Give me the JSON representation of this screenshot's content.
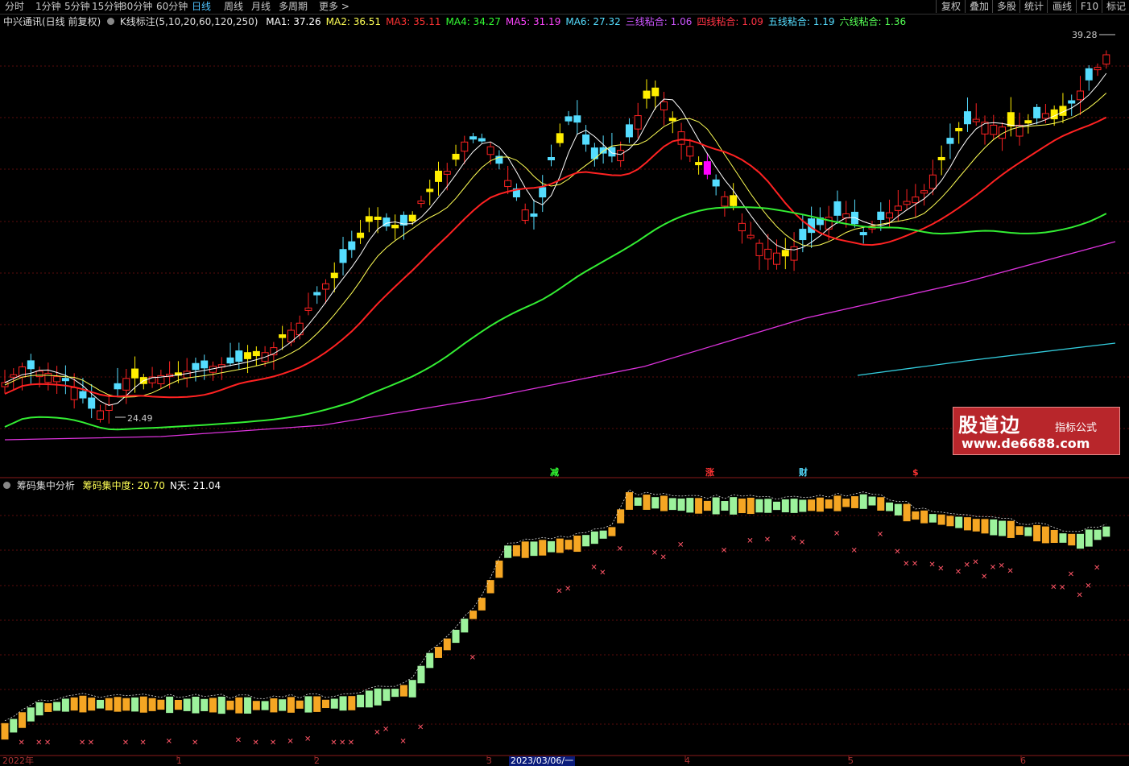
{
  "toolbar": {
    "left": [
      "分时",
      "1分钟",
      "5分钟",
      "15分钟",
      "30分钟",
      "60分钟",
      "日线",
      "周线",
      "月线",
      "多周期",
      "更多 >"
    ],
    "active_index": 6,
    "right": [
      "复权",
      "叠加",
      "多股",
      "统计",
      "画线",
      "F10",
      "标记"
    ]
  },
  "main_legend": {
    "stock": "中兴通讯(日线 前复权)",
    "indicator": "K线标注(5,10,20,60,120,250)",
    "items": [
      {
        "label": "MA1: 37.26",
        "color": "#ffffff"
      },
      {
        "label": "MA2: 36.51",
        "color": "#ffff55"
      },
      {
        "label": "MA3: 35.11",
        "color": "#ff3333"
      },
      {
        "label": "MA4: 34.27",
        "color": "#33ff33"
      },
      {
        "label": "MA5: 31.19",
        "color": "#ff44ff"
      },
      {
        "label": "MA6: 27.32",
        "color": "#55ddff"
      },
      {
        "label": "三线粘合: 1.06",
        "color": "#cc55ff"
      },
      {
        "label": "四线粘合: 1.09",
        "color": "#ff3344"
      },
      {
        "label": "五线粘合: 1.19",
        "color": "#55ddff"
      },
      {
        "label": "六线粘合: 1.36",
        "color": "#55ff55"
      }
    ]
  },
  "price_labels": {
    "high": "39.28",
    "low": "24.49"
  },
  "markers": [
    {
      "text": "减",
      "color": "#33ff33"
    },
    {
      "text": "涨",
      "color": "#ff3333"
    },
    {
      "text": "财",
      "color": "#55ddff"
    },
    {
      "text": "$",
      "color": "#ff3333"
    }
  ],
  "sub_legend": {
    "name": "筹码集中分析",
    "items": [
      {
        "label": "筹码集中度: 20.70",
        "color": "#ffff55"
      },
      {
        "label": "N天: 21.04",
        "color": "#ffffff"
      }
    ]
  },
  "x_axis": {
    "labels": [
      "2022年",
      "1",
      "2",
      "3",
      "2023/03/06/一",
      "4",
      "5",
      "6"
    ]
  },
  "watermark": {
    "brand": "股道边",
    "tag": "指标公式",
    "url": "www.de6688.com"
  },
  "colors": {
    "up": "#ff2222",
    "down": "#55ddff",
    "yellow": "#ffee00",
    "magenta": "#ff00ff",
    "orange": "#f5a623",
    "lightgreen": "#9cf29c",
    "grid": "#5a0d0d"
  }
}
